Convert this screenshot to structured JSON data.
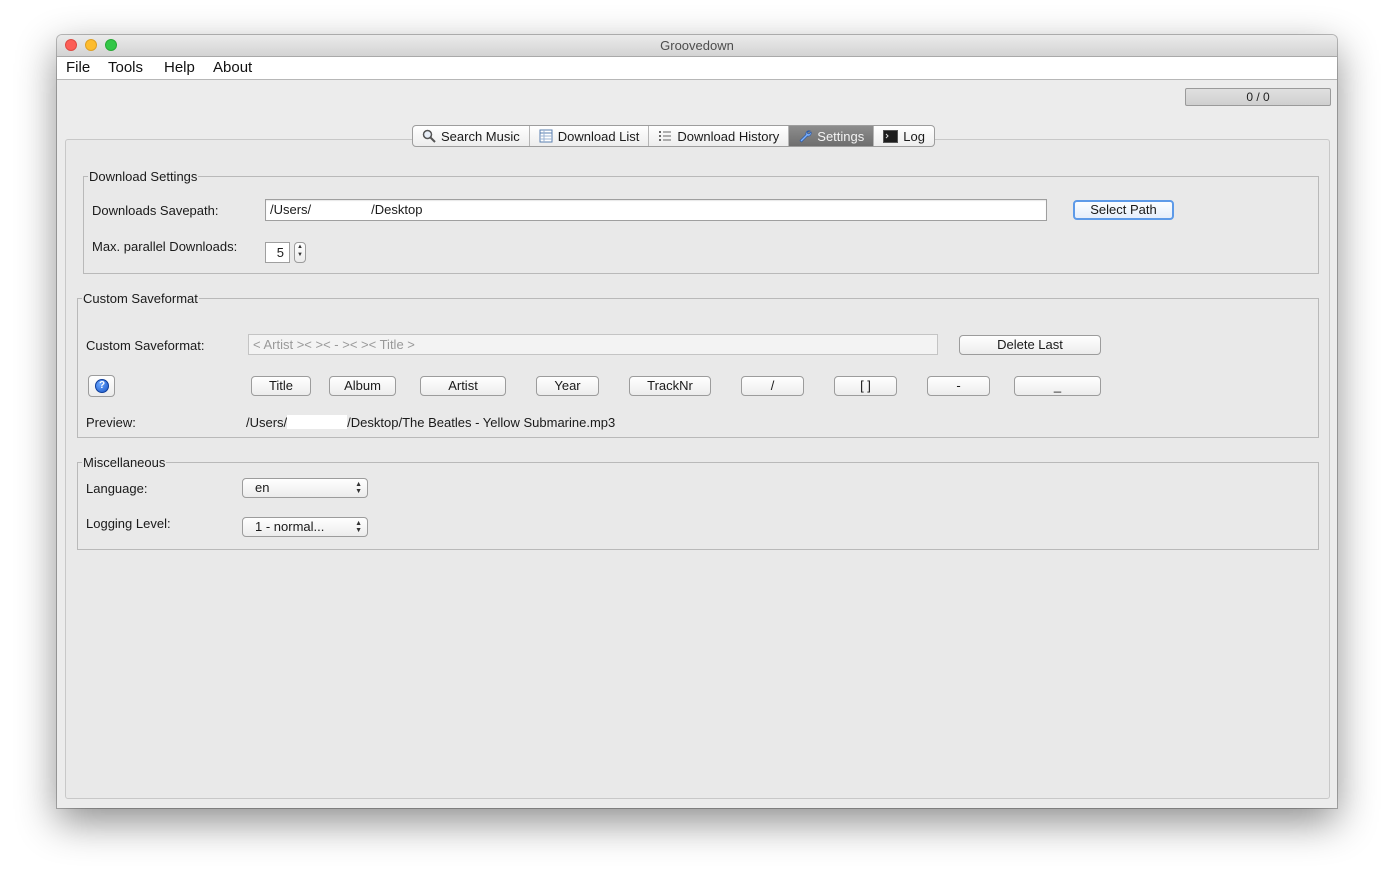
{
  "window": {
    "title": "Groovedown"
  },
  "menu": [
    "File",
    "Tools",
    "Help",
    "About"
  ],
  "counter": "0 / 0",
  "tabs": [
    {
      "label": "Search Music",
      "icon": "magnifier-icon"
    },
    {
      "label": "Download List",
      "icon": "table-icon"
    },
    {
      "label": "Download History",
      "icon": "list-icon"
    },
    {
      "label": "Settings",
      "icon": "wrench-icon",
      "active": true
    },
    {
      "label": "Log",
      "icon": "terminal-icon"
    }
  ],
  "download_settings": {
    "legend": "Download Settings",
    "savepath_label": "Downloads Savepath:",
    "savepath_prefix": "/Users/",
    "savepath_suffix": "/Desktop",
    "select_path_button": "Select Path",
    "parallel_label": "Max. parallel Downloads:",
    "parallel_value": "5"
  },
  "custom_saveformat": {
    "legend": "Custom Saveformat",
    "label": "Custom Saveformat:",
    "value": "< Artist ><  >< - ><  >< Title >",
    "delete_last_button": "Delete Last",
    "tokens": [
      "Title",
      "Album",
      "Artist",
      "Year",
      "TrackNr",
      "/",
      "[ ]",
      "-",
      "_"
    ],
    "preview_label": "Preview:",
    "preview_prefix": "/Users/",
    "preview_suffix": "/Desktop/The Beatles - Yellow Submarine.mp3"
  },
  "misc": {
    "legend": "Miscellaneous",
    "language_label": "Language:",
    "language_value": "en",
    "logging_label": "Logging Level:",
    "logging_value": "1 - normal..."
  }
}
